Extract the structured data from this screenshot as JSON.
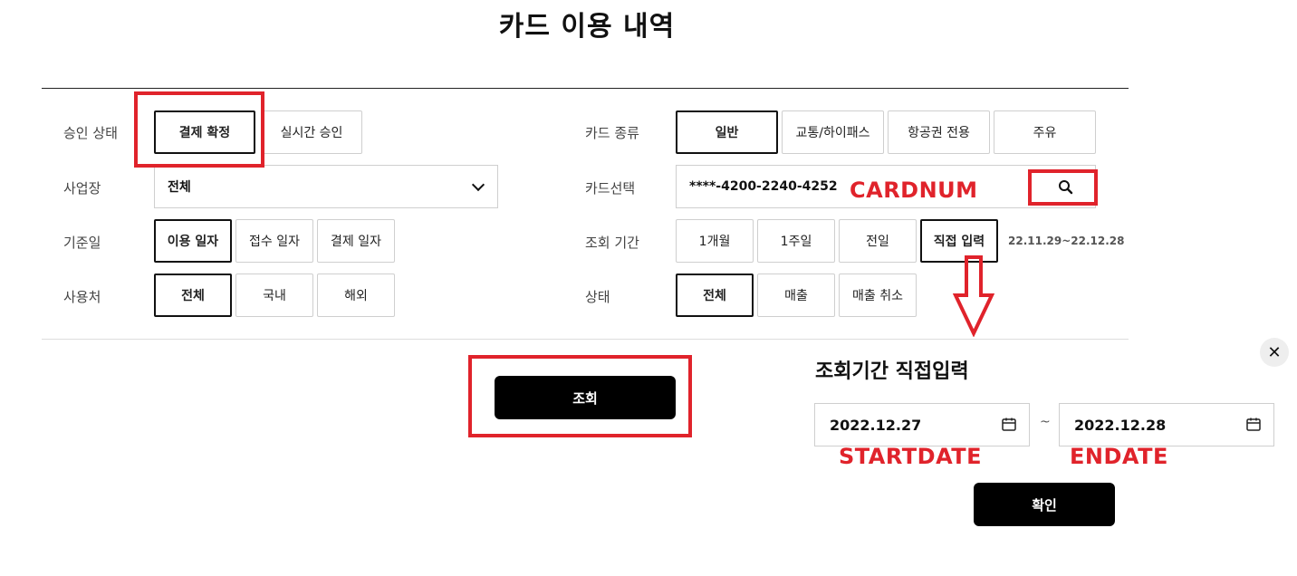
{
  "page": {
    "title": "카드 이용 내역"
  },
  "filters": {
    "approval_status": {
      "label": "승인 상태",
      "options": [
        "결제 확정",
        "실시간 승인"
      ],
      "selected": "결제 확정"
    },
    "business": {
      "label": "사업장",
      "value": "전체"
    },
    "base_date": {
      "label": "기준일",
      "options": [
        "이용 일자",
        "접수 일자",
        "결제 일자"
      ],
      "selected": "이용 일자"
    },
    "usage_place": {
      "label": "사용처",
      "options": [
        "전체",
        "국내",
        "해외"
      ],
      "selected": "전체"
    },
    "card_type": {
      "label": "카드 종류",
      "options": [
        "일반",
        "교통/하이패스",
        "항공권 전용",
        "주유"
      ],
      "selected": "일반"
    },
    "card_select": {
      "label": "카드선택",
      "value": "****-4200-2240-4252"
    },
    "period": {
      "label": "조회 기간",
      "options": [
        "1개월",
        "1주일",
        "전일",
        "직접 입력"
      ],
      "selected": "직접 입력",
      "range_text": "22.11.29~22.12.28"
    },
    "status": {
      "label": "상태",
      "options": [
        "전체",
        "매출",
        "매출 취소"
      ],
      "selected": "전체"
    }
  },
  "actions": {
    "search_label": "조회"
  },
  "popup": {
    "title": "조회기간 직접입력",
    "close_label": "✕",
    "start_date": "2022.12.27",
    "separator": "~",
    "end_date": "2022.12.28",
    "confirm_label": "확인"
  },
  "annotations": {
    "cardnum": "CARDNUM",
    "startdate": "STARTDATE",
    "enddate": "ENDATE"
  },
  "colors": {
    "annotation_red": "#e0232b",
    "primary_black": "#000000"
  }
}
